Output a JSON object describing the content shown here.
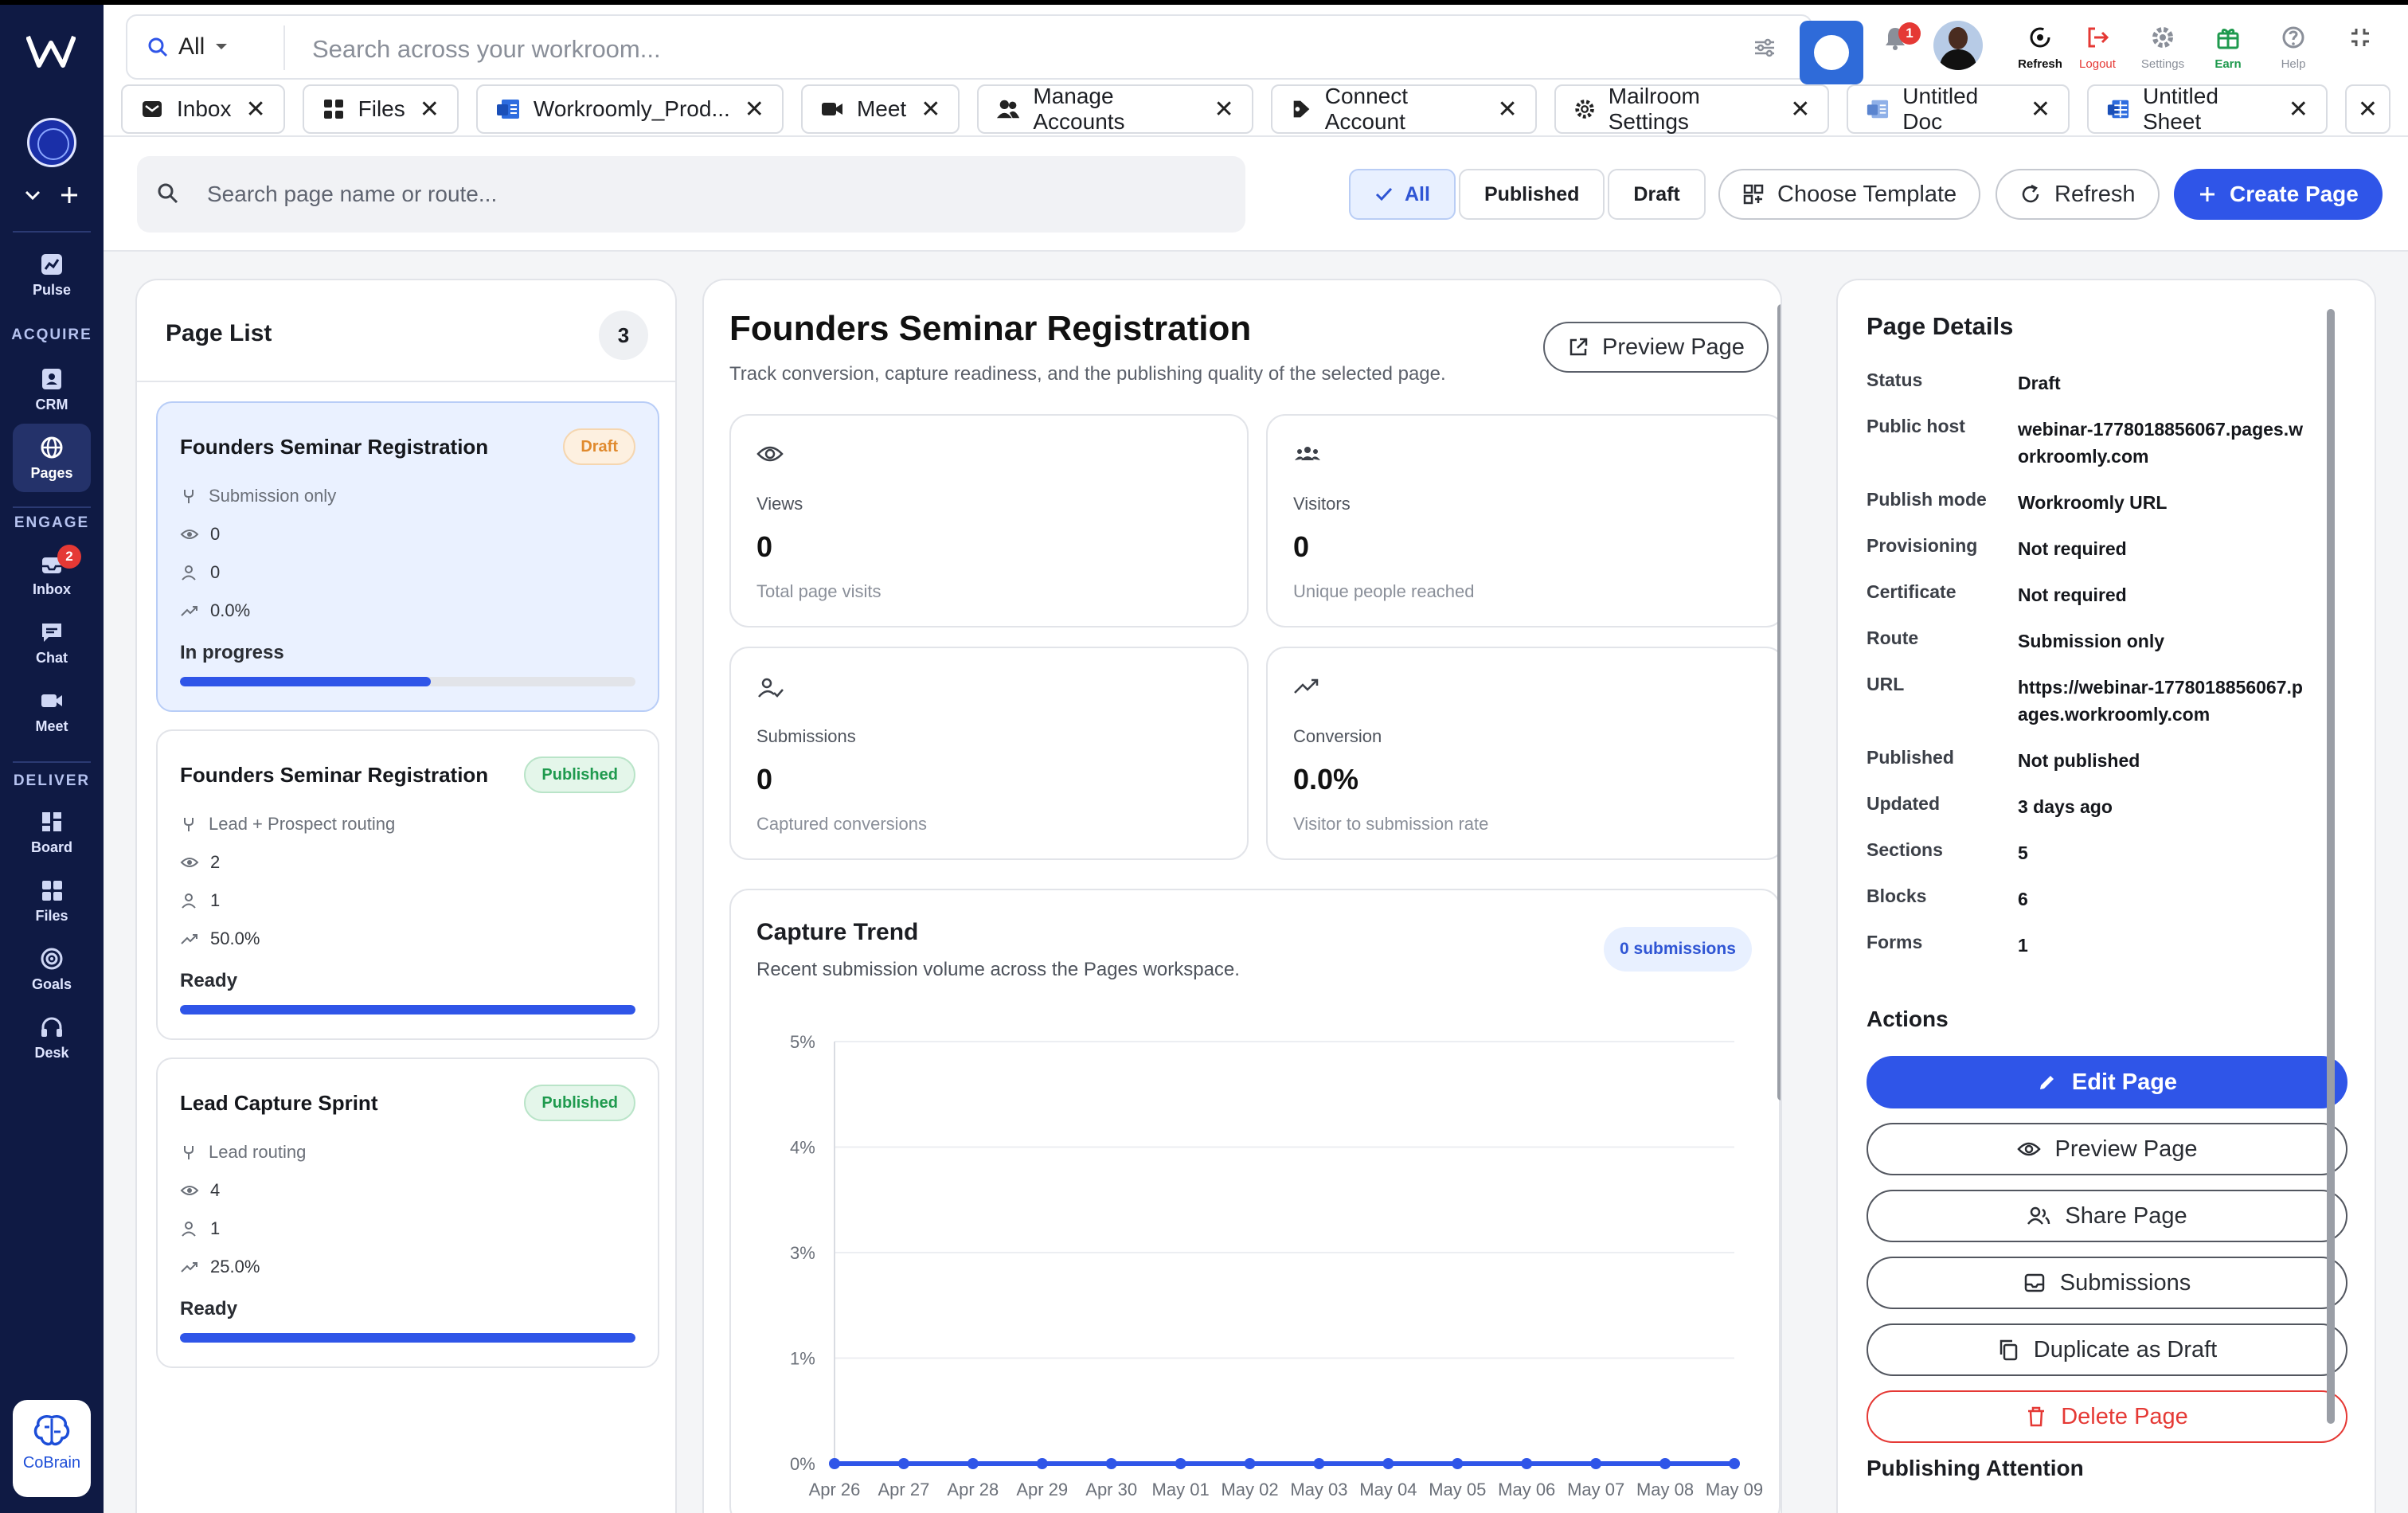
{
  "sidebar": {
    "sections": {
      "acquire": "ACQUIRE",
      "engage": "ENGAGE",
      "deliver": "DELIVER"
    },
    "items": [
      {
        "label": "Pulse"
      },
      {
        "label": "CRM"
      },
      {
        "label": "Pages"
      },
      {
        "label": "Inbox",
        "badge": "2"
      },
      {
        "label": "Chat"
      },
      {
        "label": "Meet"
      },
      {
        "label": "Board"
      },
      {
        "label": "Files"
      },
      {
        "label": "Goals"
      },
      {
        "label": "Desk"
      }
    ],
    "cobrain": "CoBrain"
  },
  "topbar": {
    "scope": "All",
    "search_placeholder": "Search across your workroom...",
    "notifications": "1",
    "icons": [
      {
        "label": "Refresh",
        "color": "#111111"
      },
      {
        "label": "Logout",
        "color": "#e53935"
      },
      {
        "label": "Settings",
        "color": "#8a8f99"
      },
      {
        "label": "Earn",
        "color": "#1f9a4e"
      },
      {
        "label": "Help",
        "color": "#8a8f99"
      }
    ]
  },
  "tabs": [
    {
      "label": "Inbox",
      "icon": "inbox-icon"
    },
    {
      "label": "Files",
      "icon": "files-icon"
    },
    {
      "label": "Workroomly_Prod...",
      "icon": "doc-icon"
    },
    {
      "label": "Meet",
      "icon": "video-icon"
    },
    {
      "label": "Manage Accounts",
      "icon": "users-icon"
    },
    {
      "label": "Connect Account",
      "icon": "connect-icon"
    },
    {
      "label": "Mailroom Settings",
      "icon": "gear-icon"
    },
    {
      "label": "Untitled Doc",
      "icon": "doc-icon"
    },
    {
      "label": "Untitled Sheet",
      "icon": "sheet-icon"
    }
  ],
  "toolbar": {
    "search_placeholder": "Search page name or route...",
    "filters": [
      "All",
      "Published",
      "Draft"
    ],
    "active_filter": "All",
    "choose_template": "Choose Template",
    "refresh": "Refresh",
    "create_page": "Create Page"
  },
  "page_list": {
    "title": "Page List",
    "count": "3",
    "items": [
      {
        "title": "Founders Seminar Registration",
        "status": "Draft",
        "route": "Submission only",
        "views": "0",
        "visitors": "0",
        "conversion": "0.0%",
        "progress_label": "In progress",
        "progress": 0.55
      },
      {
        "title": "Founders Seminar Registration",
        "status": "Published",
        "route": "Lead + Prospect routing",
        "views": "2",
        "visitors": "1",
        "conversion": "50.0%",
        "progress_label": "Ready",
        "progress": 1.0
      },
      {
        "title": "Lead Capture Sprint",
        "status": "Published",
        "route": "Lead routing",
        "views": "4",
        "visitors": "1",
        "conversion": "25.0%",
        "progress_label": "Ready",
        "progress": 1.0
      }
    ]
  },
  "overview": {
    "title": "Founders Seminar Registration",
    "subtitle": "Track conversion, capture readiness, and the publishing quality of the selected page.",
    "preview_button": "Preview Page",
    "stats": [
      {
        "label": "Views",
        "value": "0",
        "sub": "Total page visits",
        "icon": "eye-icon"
      },
      {
        "label": "Visitors",
        "value": "0",
        "sub": "Unique people reached",
        "icon": "people-icon"
      },
      {
        "label": "Submissions",
        "value": "0",
        "sub": "Captured conversions",
        "icon": "user-check-icon"
      },
      {
        "label": "Conversion",
        "value": "0.0%",
        "sub": "Visitor to submission rate",
        "icon": "trend-icon"
      }
    ],
    "trend": {
      "title": "Capture Trend",
      "subtitle": "Recent submission volume across the Pages workspace.",
      "badge": "0 submissions"
    }
  },
  "chart_data": {
    "type": "line",
    "title": "Capture Trend",
    "x": [
      "Apr 26",
      "Apr 27",
      "Apr 28",
      "Apr 29",
      "Apr 30",
      "May 01",
      "May 02",
      "May 03",
      "May 04",
      "May 05",
      "May 06",
      "May 07",
      "May 08",
      "May 09"
    ],
    "series": [
      {
        "values": [
          0,
          0,
          0,
          0,
          0,
          0,
          0,
          0,
          0,
          0,
          0,
          0,
          0,
          0
        ],
        "color": "#2f55e8"
      }
    ],
    "yticks": [
      "5%",
      "4%",
      "3%",
      "1%",
      "0%"
    ],
    "ylim": [
      0,
      5
    ],
    "grid": true
  },
  "details": {
    "title": "Page Details",
    "rows": [
      {
        "k": "Status",
        "v": "Draft"
      },
      {
        "k": "Public host",
        "v": "webinar-1778018856067.pages.workroomly.com"
      },
      {
        "k": "Publish mode",
        "v": "Workroomly URL"
      },
      {
        "k": "Provisioning",
        "v": "Not required"
      },
      {
        "k": "Certificate",
        "v": "Not required"
      },
      {
        "k": "Route",
        "v": "Submission only"
      },
      {
        "k": "URL",
        "v": "https://webinar-1778018856067.pages.workroomly.com"
      },
      {
        "k": "Published",
        "v": "Not published"
      },
      {
        "k": "Updated",
        "v": "3 days ago"
      },
      {
        "k": "Sections",
        "v": "5"
      },
      {
        "k": "Blocks",
        "v": "6"
      },
      {
        "k": "Forms",
        "v": "1"
      }
    ],
    "actions_title": "Actions",
    "actions": [
      "Edit Page",
      "Preview Page",
      "Share Page",
      "Submissions",
      "Duplicate as Draft",
      "Delete Page"
    ],
    "attention_title": "Publishing Attention"
  }
}
